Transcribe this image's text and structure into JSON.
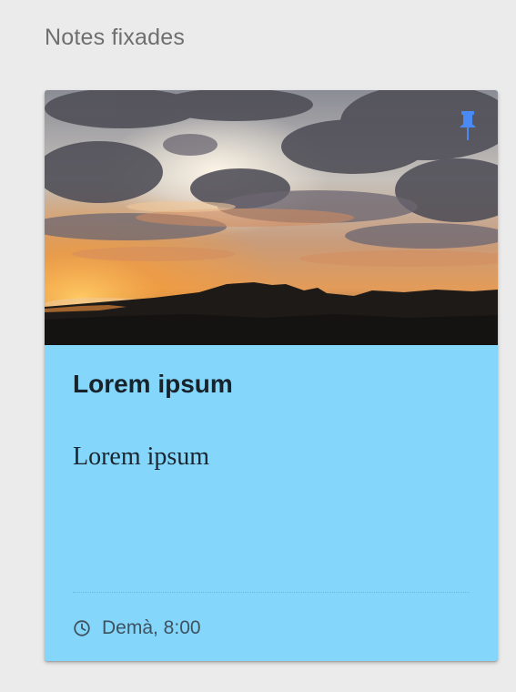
{
  "section": {
    "title": "Notes fixades"
  },
  "note": {
    "title": "Lorem ipsum",
    "body": "Lorem ipsum",
    "reminder": "Demà, 8:00",
    "image_alt": "sunset-landscape-photo",
    "pinned": true
  },
  "icons": {
    "pin": "pin-icon",
    "clock": "clock-icon"
  },
  "colors": {
    "panel_background": "#ebebeb",
    "card_background": "#84d6fb",
    "pin_color": "#4a8af4",
    "title_text": "#17222b",
    "secondary_text": "#3e5260"
  }
}
